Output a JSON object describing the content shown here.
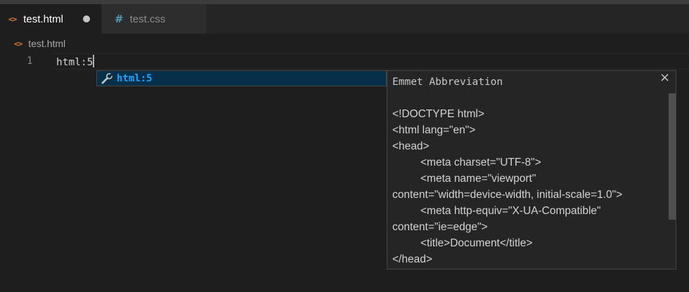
{
  "tabs": [
    {
      "label": "test.html",
      "icon": "html-file-icon",
      "active": true,
      "dirty": true
    },
    {
      "label": "test.css",
      "icon": "css-file-icon",
      "active": false
    }
  ],
  "breadcrumb": {
    "label": "test.html",
    "icon": "html-file-icon"
  },
  "editor": {
    "line_number": "1",
    "line_text": "html:5"
  },
  "suggest": {
    "label": "html:5",
    "icon": "wrench-icon"
  },
  "details": {
    "title": "Emmet Abbreviation",
    "close_glyph": "×",
    "lines": [
      "<!DOCTYPE html>",
      "<html lang=\"en\">",
      "<head>",
      "<meta charset=\"UTF-8\">",
      "<meta name=\"viewport\"",
      "content=\"width=device-width, initial-scale=1.0\">",
      "<meta http-equiv=\"X-UA-Compatible\"",
      "content=\"ie=edge\">",
      "<title>Document</title>",
      "</head>"
    ]
  },
  "colors": {
    "html_icon": "#e37933",
    "css_icon": "#519aba",
    "suggest_highlight": "#062f4a",
    "suggest_text": "#18a3ff"
  }
}
